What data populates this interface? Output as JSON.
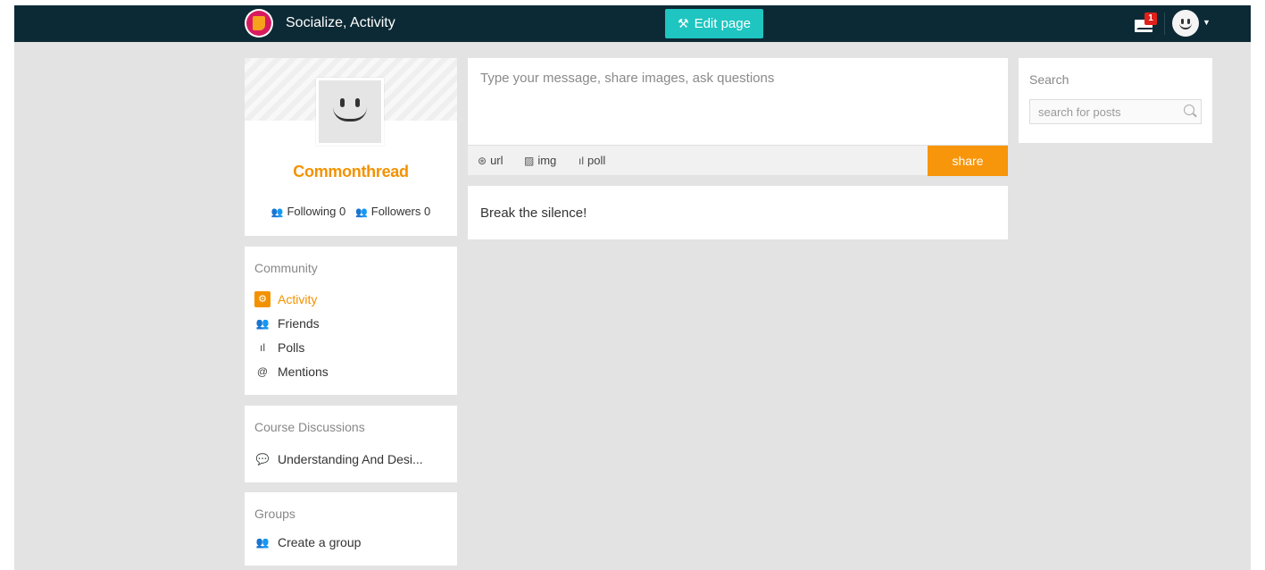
{
  "topbar": {
    "title": "Socialize, Activity",
    "edit_label": "Edit page",
    "mail_count": "1",
    "brand_color": "#0c2a35",
    "accent": "#1fc5c0"
  },
  "profile": {
    "name": "Commonthread",
    "following": "Following 0",
    "followers": "Followers 0"
  },
  "community": {
    "title": "Community",
    "items": [
      {
        "label": "Activity",
        "icon": "cog-icon",
        "active": true
      },
      {
        "label": "Friends",
        "icon": "people-icon",
        "active": false
      },
      {
        "label": "Polls",
        "icon": "bar-chart-icon",
        "active": false
      },
      {
        "label": "Mentions",
        "icon": "at-icon",
        "active": false
      }
    ]
  },
  "courses": {
    "title": "Course Discussions",
    "items": [
      {
        "label": "Understanding And Desi...",
        "icon": "chat-icon"
      }
    ]
  },
  "groups": {
    "title": "Groups",
    "items": [
      {
        "label": "Create a group",
        "icon": "add-group-icon"
      }
    ]
  },
  "composer": {
    "placeholder": "Type your message, share images, ask questions",
    "tools": {
      "url": "url",
      "img": "img",
      "poll": "poll"
    },
    "share_label": "share",
    "share_color": "#f7960a"
  },
  "feed": {
    "empty_text": "Break the silence!"
  },
  "search": {
    "title": "Search",
    "placeholder": "search for posts"
  }
}
